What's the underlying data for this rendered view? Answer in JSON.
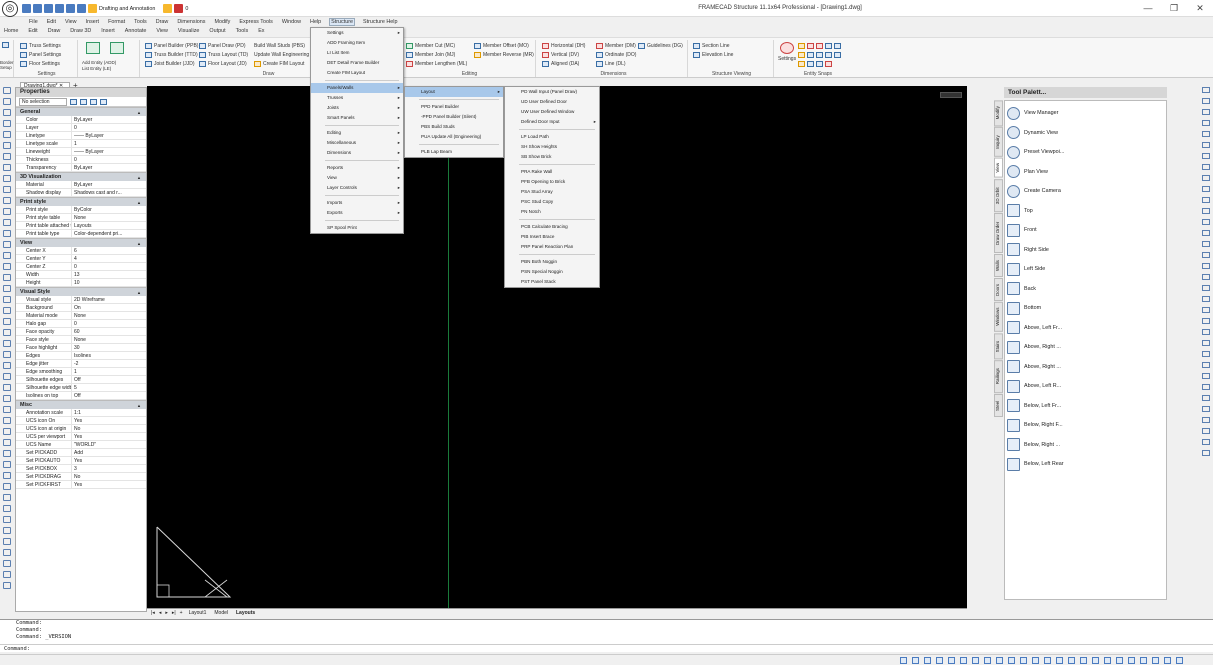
{
  "app": {
    "window_title": "FRAMECAD Structure 11.1x64 Professional - [Drawing1.dwg]",
    "qat_label": "Drafting and Annotation",
    "qat_layer": "0"
  },
  "menubar": [
    "File",
    "Edit",
    "View",
    "Insert",
    "Format",
    "Tools",
    "Draw",
    "Dimensions",
    "Modify",
    "Express Tools",
    "Window",
    "Help",
    "Structure",
    "Structure Help"
  ],
  "ribbon_tabs": [
    "Home",
    "Edit",
    "Draw",
    "Draw 3D",
    "Insert",
    "Annotate",
    "View",
    "Visualize",
    "Output",
    "Tools",
    "Ex"
  ],
  "ribbon": {
    "border_setup": "Border Setup",
    "settings_group": {
      "label": "Settings",
      "items": [
        "Truss Settings",
        "Panel Settings",
        "Floor Settings"
      ]
    },
    "entity_items": [
      "Add Entity (ADD)",
      "List Entity (LE)"
    ],
    "draw_group": {
      "label": "Draw",
      "items": [
        "Panel Builder (PPB)",
        "Truss Builder (TTD)",
        "Joist Builder (JJD)",
        "Panel Draw (PD)",
        "Truss Layout (TD)",
        "Floor Layout (JD)",
        "Build Wall Studs (PBS)",
        "Update Wall Engineering",
        "Create FIM Layout"
      ]
    },
    "editing_group": {
      "label": "Editing",
      "items": [
        "Member Cut (MC)",
        "Member Join (MJ)",
        "Member Lengthen (ML)",
        "Member Offset (MO)",
        "Member Reverse (MR)"
      ]
    },
    "dimensions_group": {
      "label": "Dimensions",
      "items": [
        "Horizontal (DH)",
        "Vertical (DV)",
        "Aligned (DA)",
        "Member (DM)",
        "Ordinate (DO)",
        "Line (DL)",
        "Guidelines (DG)"
      ]
    },
    "viewing_group": {
      "label": "Structure Viewing",
      "items": [
        "Section Line",
        "Elevation Line"
      ]
    },
    "snaps_group": {
      "label": "Entity Snaps",
      "settings": "Settings"
    }
  },
  "doc_tab": "Drawing1.dwg*",
  "properties": {
    "title": "Properties",
    "selection": "No selection",
    "sections": [
      {
        "name": "General",
        "rows": [
          [
            "Color",
            "ByLayer"
          ],
          [
            "Layer",
            "0"
          ],
          [
            "Linetype",
            "—— ByLayer"
          ],
          [
            "Linetype scale",
            "1"
          ],
          [
            "Lineweight",
            "—— ByLayer"
          ],
          [
            "Thickness",
            "0"
          ],
          [
            "Transparency",
            "ByLayer"
          ]
        ]
      },
      {
        "name": "3D Visualization",
        "rows": [
          [
            "Material",
            "ByLayer"
          ],
          [
            "Shadow display",
            "Shadows cast and r..."
          ]
        ]
      },
      {
        "name": "Print style",
        "rows": [
          [
            "Print style",
            "ByColor"
          ],
          [
            "Print style table",
            "None"
          ],
          [
            "Print table attached to",
            "Layouts"
          ],
          [
            "Print table type",
            "Color-dependent pri..."
          ]
        ]
      },
      {
        "name": "View",
        "rows": [
          [
            "Center X",
            "6"
          ],
          [
            "Center Y",
            "4"
          ],
          [
            "Center Z",
            "0"
          ],
          [
            "Width",
            "13"
          ],
          [
            "Height",
            "10"
          ]
        ]
      },
      {
        "name": "Visual Style",
        "rows": [
          [
            "Visual style",
            "2D Wireframe"
          ],
          [
            "Background",
            "On"
          ],
          [
            "Material mode",
            "None"
          ],
          [
            "Halo gap",
            "0"
          ],
          [
            "Face opacity",
            "60"
          ],
          [
            "Face style",
            "None"
          ],
          [
            "Face highlight",
            "30"
          ],
          [
            "Edges",
            "Isolines"
          ],
          [
            "Edge jitter",
            "-2"
          ],
          [
            "Edge smoothing",
            "1"
          ],
          [
            "Silhouette edges",
            "Off"
          ],
          [
            "Silhouette edge width",
            "5"
          ],
          [
            "Isolines on top",
            "Off"
          ]
        ]
      },
      {
        "name": "Misc",
        "rows": [
          [
            "Annotation scale",
            "1:1"
          ],
          [
            "UCS icon On",
            "Yes"
          ],
          [
            "UCS icon at origin",
            "No"
          ],
          [
            "UCS per viewport",
            "Yes"
          ],
          [
            "UCS Name",
            "\"WORLD\""
          ],
          [
            "Set PICKADD",
            "Add"
          ],
          [
            "Set PICKAUTO",
            "Yes"
          ],
          [
            "Set PICKBOX",
            "3"
          ],
          [
            "Set PICKDRAG",
            "No"
          ],
          [
            "Set PICKFIRST",
            "Yes"
          ]
        ]
      }
    ]
  },
  "structure_menu": [
    {
      "label": "Settings",
      "arrow": true
    },
    {
      "label": "ADD Framing Item",
      "arrow": false
    },
    {
      "label": "LI List Item",
      "arrow": false
    },
    {
      "label": "DET Detail Frame Builder",
      "arrow": false
    },
    {
      "label": "Create FIM Layout",
      "arrow": false
    },
    {
      "sep": true
    },
    {
      "label": "Panels/Walls",
      "arrow": true,
      "hl": true
    },
    {
      "label": "Trusses",
      "arrow": true
    },
    {
      "label": "Joists",
      "arrow": true
    },
    {
      "label": "Smart Panels",
      "arrow": true
    },
    {
      "sep": true
    },
    {
      "label": "Editing",
      "arrow": true
    },
    {
      "label": "Miscellaneous",
      "arrow": true
    },
    {
      "label": "Dimensions",
      "arrow": true
    },
    {
      "sep": true
    },
    {
      "label": "Reports",
      "arrow": true
    },
    {
      "label": "View",
      "arrow": true
    },
    {
      "label": "Layer Controls",
      "arrow": true
    },
    {
      "sep": true
    },
    {
      "label": "Imports",
      "arrow": true
    },
    {
      "label": "Exports",
      "arrow": true
    },
    {
      "sep": true
    },
    {
      "label": "SP Spool Print",
      "arrow": false
    }
  ],
  "panels_menu": [
    {
      "label": "Layout",
      "arrow": true,
      "hl": true
    },
    {
      "sep": true
    },
    {
      "label": "PPD Panel Builder",
      "arrow": false
    },
    {
      "label": "-PPD Panel Builder (Silent)",
      "arrow": false
    },
    {
      "label": "PBS Build Studs",
      "arrow": false
    },
    {
      "label": "PUA Update All (Engineering)",
      "arrow": false
    },
    {
      "sep": true
    },
    {
      "label": "PLB Lap Beam",
      "arrow": false
    }
  ],
  "layout_menu": [
    {
      "label": "PD Wall Input (Panel Draw)",
      "arrow": false
    },
    {
      "label": "UD User Defined Door",
      "arrow": false
    },
    {
      "label": "UW User Defined Window",
      "arrow": false
    },
    {
      "label": "Defined Door Input",
      "arrow": true
    },
    {
      "sep": true
    },
    {
      "label": "LP Load Path",
      "arrow": false
    },
    {
      "label": "SH Show Heights",
      "arrow": false
    },
    {
      "label": "SB Show Brick",
      "arrow": false
    },
    {
      "sep": true
    },
    {
      "label": "PRA Rake Wall",
      "arrow": false
    },
    {
      "label": "PFB Opening to Brick",
      "arrow": false
    },
    {
      "label": "PSA Stud Array",
      "arrow": false
    },
    {
      "label": "PSC Stud Copy",
      "arrow": false
    },
    {
      "label": "PN Notch",
      "arrow": false
    },
    {
      "sep": true
    },
    {
      "label": "PCB Calculate Bracing",
      "arrow": false
    },
    {
      "label": "PIB Insert Brace",
      "arrow": false
    },
    {
      "label": "PRP Panel Reaction Plan",
      "arrow": false
    },
    {
      "sep": true
    },
    {
      "label": "PBN Both Noggin",
      "arrow": false
    },
    {
      "label": "PSN Special Noggin",
      "arrow": false
    },
    {
      "label": "PST Panel Stack",
      "arrow": false
    }
  ],
  "layout_tabs": [
    "Layout1",
    "Model",
    "Layouts"
  ],
  "command_lines": [
    "Command:",
    "Command:",
    "Command: _VERSION"
  ],
  "command_prompt": "Command:",
  "tool_palette": {
    "title": "Tool Palett...",
    "tabs": [
      "Modify",
      "Inquiry",
      "View",
      "3D Orbit",
      "Draw Order",
      "Walls",
      "Doors",
      "Windows",
      "Stairs",
      "Railings",
      "Steel"
    ],
    "active_tab": "View",
    "items": [
      "View Manager",
      "Dynamic View",
      "Preset Viewpoi...",
      "Plan View",
      "Create Camera",
      "Top",
      "Front",
      "Right Side",
      "Left Side",
      "Back",
      "Bottom",
      "Above, Left Fr...",
      "Above, Right ...",
      "Above, Right ...",
      "Above, Left R...",
      "Below, Left Fr...",
      "Below, Right F...",
      "Below, Right ...",
      "Below, Left Rear"
    ]
  },
  "status": {
    "coords_hint": "Polar"
  }
}
